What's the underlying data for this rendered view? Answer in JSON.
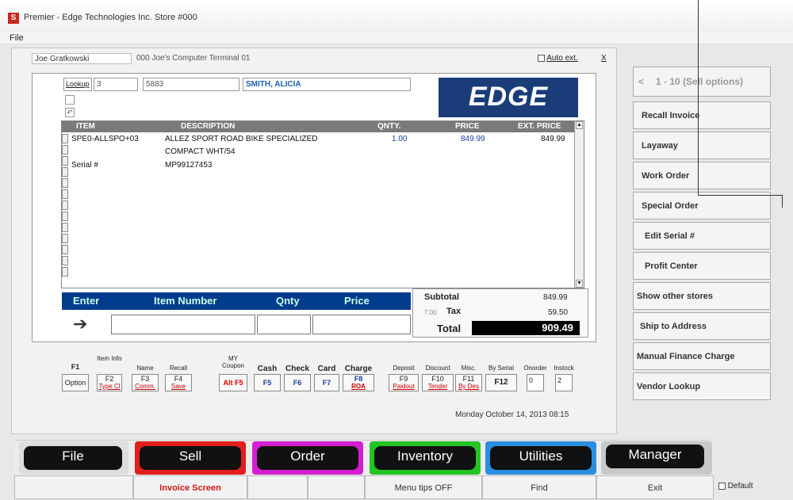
{
  "window": {
    "title": "Premier - Edge Technologies Inc. Store #000",
    "icon": "app-icon"
  },
  "menu": {
    "file": "File"
  },
  "header": {
    "user": "Joe Gratkowski",
    "terminal": "000 Joe's Computer  Terminal 01",
    "auto_ext": "Auto ext.",
    "close": "X"
  },
  "lookup": {
    "label": "Lookup",
    "field1": "3",
    "field2": "5883",
    "customer": "SMITH, ALICIA"
  },
  "logo_text": "EDGE",
  "grid": {
    "headers": [
      "ITEM",
      "DESCRIPTION",
      "QNTY.",
      "PRICE",
      "EXT. PRICE"
    ],
    "rows": [
      {
        "item": "SPE0-ALLSPO+03",
        "description": "ALLEZ SPORT ROAD BIKE SPECIALIZED",
        "qnty": "1.00",
        "price": "849.99",
        "ext": "849.99"
      },
      {
        "item": "",
        "description": "COMPACT WHT/54",
        "qnty": "",
        "price": "",
        "ext": ""
      },
      {
        "item": "Serial #",
        "description": "MP99127453",
        "qnty": "",
        "price": "",
        "ext": ""
      }
    ]
  },
  "entry": {
    "enter": "Enter",
    "item_number": "Item Number",
    "qnty": "Qnty",
    "price": "Price",
    "arrow": "➔"
  },
  "totals": {
    "subtotal_label": "Subtotal",
    "subtotal": "849.99",
    "tax_rate": "7.00",
    "tax_label": "Tax",
    "tax": "59.50",
    "total_label": "Total",
    "total": "909.49"
  },
  "fkeys": [
    {
      "top": "F1",
      "key": "Option",
      "sub": ""
    },
    {
      "top": "Item Info",
      "key": "F2",
      "sub": "Type Cl"
    },
    {
      "top": "Name",
      "key": "F3",
      "sub": "Comm."
    },
    {
      "top": "Recall",
      "key": "F4",
      "sub": "Save"
    },
    {
      "top": "MY Coupon",
      "key": "Alt F5",
      "sub": ""
    },
    {
      "top": "Cash",
      "key": "F5",
      "sub": ""
    },
    {
      "top": "Check",
      "key": "F6",
      "sub": ""
    },
    {
      "top": "Card",
      "key": "F7",
      "sub": ""
    },
    {
      "top": "Charge",
      "key": "F8",
      "sub": "ROA"
    },
    {
      "top": "Deposit",
      "key": "F9",
      "sub": "Paidout"
    },
    {
      "top": "Discount",
      "key": "F10",
      "sub": "Tender"
    },
    {
      "top": "Misc.",
      "key": "F11",
      "sub": "By Des"
    },
    {
      "top": "By Serial",
      "key": "F12",
      "sub": ""
    },
    {
      "top": "Onorder",
      "key": "0",
      "sub": ""
    },
    {
      "top": "Instock",
      "key": "2",
      "sub": ""
    }
  ],
  "datetime": "Monday  October 14, 2013  08:15",
  "side": {
    "pager": "<",
    "pager_label": "1 - 10 (Sell options)",
    "buttons": [
      "Recall Invoice",
      "Layaway",
      "Work Order",
      "Special Order",
      "Edit Serial #",
      "Profit Center",
      "Show other stores",
      "Ship to Address",
      "Manual Finance Charge",
      "Vendor Lookup"
    ]
  },
  "tabs": [
    {
      "label": "File",
      "color": "#202020"
    },
    {
      "label": "Sell",
      "color": "#e31e1e"
    },
    {
      "label": "Order",
      "color": "#d21fd2"
    },
    {
      "label": "Inventory",
      "color": "#22c522"
    },
    {
      "label": "Utilities",
      "color": "#2a8ee0"
    },
    {
      "label": "Manager",
      "color": "#3a3a3a"
    }
  ],
  "bottom": {
    "invoice": "Invoice Screen",
    "tips": "Menu tips OFF",
    "find": "Find",
    "exit": "Exit",
    "default": "Default"
  }
}
